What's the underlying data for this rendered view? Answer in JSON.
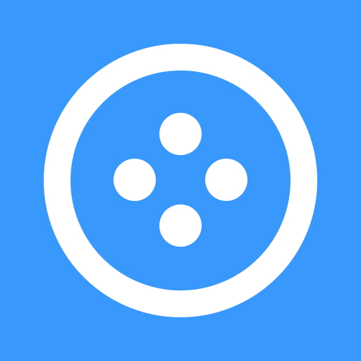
{
  "icon": {
    "name": "gamepad-circle-icon",
    "background_color": "#3898FC",
    "foreground_color": "#FFFFFF",
    "dot_count": 4
  }
}
